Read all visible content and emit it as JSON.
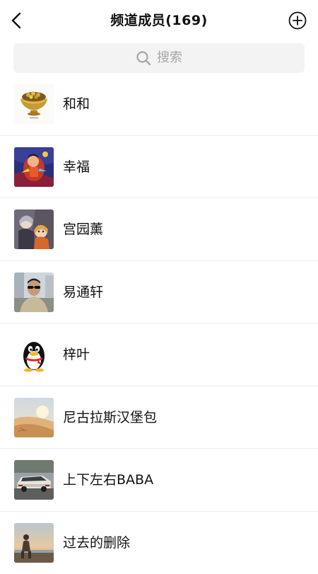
{
  "header": {
    "title": "频道成员(169)",
    "back_icon": "chevron-left-icon",
    "add_icon": "plus-circle-icon"
  },
  "search": {
    "placeholder": "搜索",
    "icon": "search-icon"
  },
  "members": [
    {
      "name": "和和",
      "avatar": "gold-bowl-avatar"
    },
    {
      "name": "幸福",
      "avatar": "cartoon-hero-avatar"
    },
    {
      "name": "宫园薰",
      "avatar": "anime-characters-avatar"
    },
    {
      "name": "易通轩",
      "avatar": "man-sunglasses-avatar"
    },
    {
      "name": "梓叶",
      "avatar": "penguin-avatar"
    },
    {
      "name": "尼古拉斯汉堡包",
      "avatar": "desert-dunes-avatar"
    },
    {
      "name": "上下左右BABA",
      "avatar": "vintage-car-avatar"
    },
    {
      "name": "过去的删除",
      "avatar": "person-sunset-avatar"
    }
  ],
  "colors": {
    "background": "#ffffff",
    "search_background": "#f3f3f3",
    "placeholder": "#a6a6a6",
    "divider": "#ededed",
    "text": "#111111"
  }
}
